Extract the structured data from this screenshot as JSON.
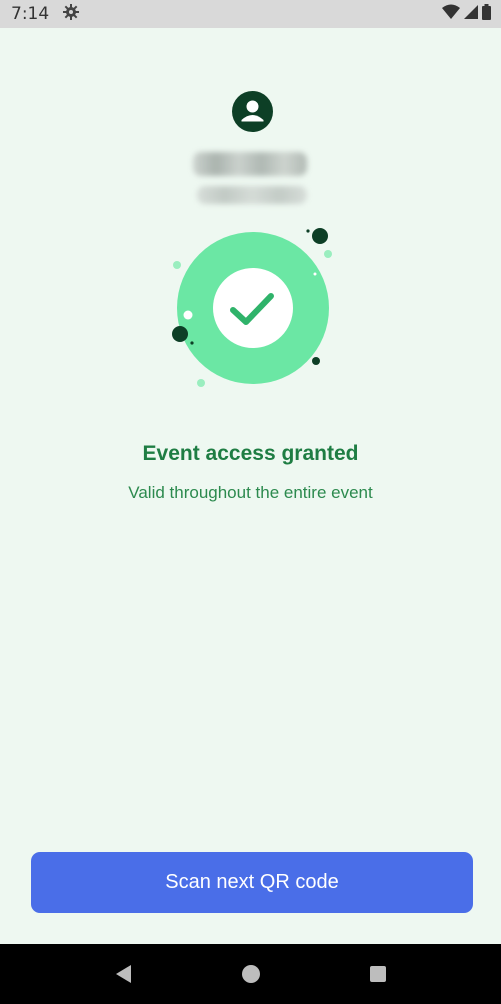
{
  "status_bar": {
    "time": "7:14",
    "icons": [
      "settings-icon",
      "wifi-icon",
      "signal-icon",
      "battery-icon"
    ]
  },
  "attendee": {
    "avatar_icon": "person-icon",
    "name_blurred": true,
    "phone_blurred": true
  },
  "result": {
    "icon": "checkmark-icon",
    "title": "Event access granted",
    "subtitle": "Valid throughout the entire event"
  },
  "actions": {
    "scan_next_label": "Scan next QR code"
  },
  "nav_bar": {
    "buttons": [
      "back-icon",
      "home-icon",
      "recents-icon"
    ]
  },
  "colors": {
    "background": "#eef8f1",
    "accent_green": "#1e7d43",
    "badge_green": "#6be7a4",
    "button_blue": "#4a6ee8",
    "avatar_dark": "#0d3f26"
  }
}
